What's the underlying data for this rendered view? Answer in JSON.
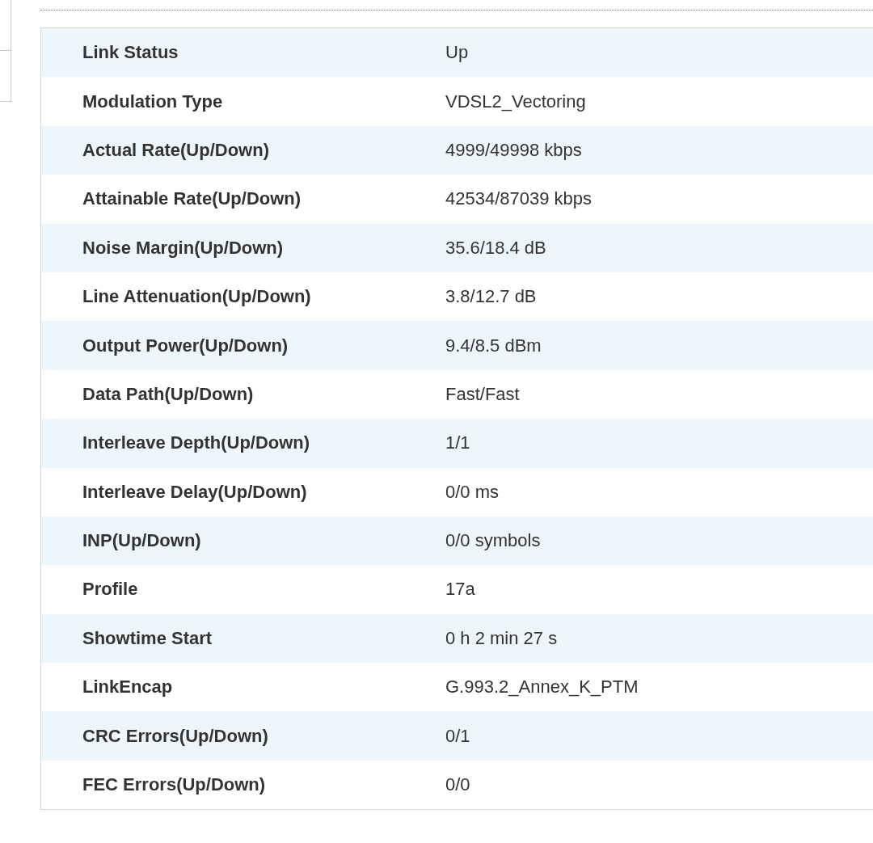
{
  "status_table": [
    {
      "label": "Link Status",
      "value": "Up"
    },
    {
      "label": "Modulation Type",
      "value": "VDSL2_Vectoring"
    },
    {
      "label": "Actual Rate(Up/Down)",
      "value": "4999/49998 kbps"
    },
    {
      "label": "Attainable Rate(Up/Down)",
      "value": "42534/87039 kbps"
    },
    {
      "label": "Noise Margin(Up/Down)",
      "value": "35.6/18.4 dB"
    },
    {
      "label": "Line Attenuation(Up/Down)",
      "value": "3.8/12.7 dB"
    },
    {
      "label": "Output Power(Up/Down)",
      "value": "9.4/8.5 dBm"
    },
    {
      "label": "Data Path(Up/Down)",
      "value": "Fast/Fast"
    },
    {
      "label": "Interleave Depth(Up/Down)",
      "value": "1/1"
    },
    {
      "label": "Interleave Delay(Up/Down)",
      "value": "0/0 ms"
    },
    {
      "label": "INP(Up/Down)",
      "value": "0/0 symbols"
    },
    {
      "label": "Profile",
      "value": "17a"
    },
    {
      "label": "Showtime Start",
      "value": "0 h 2 min 27 s"
    },
    {
      "label": "LinkEncap",
      "value": "G.993.2_Annex_K_PTM"
    },
    {
      "label": "CRC Errors(Up/Down)",
      "value": "0/1"
    },
    {
      "label": "FEC Errors(Up/Down)",
      "value": "0/0"
    }
  ]
}
